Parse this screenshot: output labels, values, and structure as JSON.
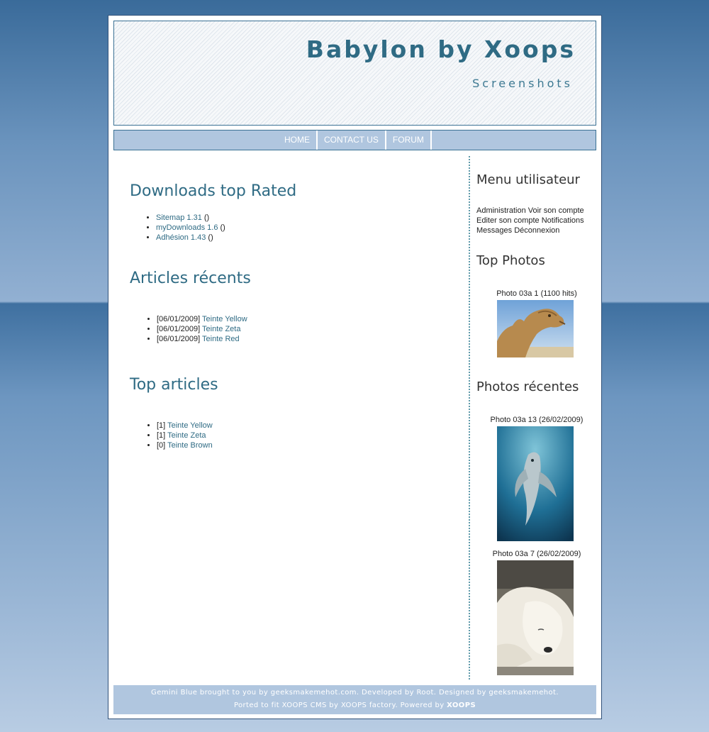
{
  "header": {
    "title": "Babylon by Xoops",
    "subtitle": "Screenshots"
  },
  "nav": {
    "items": [
      {
        "label": "HOME"
      },
      {
        "label": "CONTACT US"
      },
      {
        "label": "FORUM"
      }
    ]
  },
  "main": {
    "downloads": {
      "title": "Downloads top Rated",
      "items": [
        {
          "link": "Sitemap 1.31",
          "suffix": " ()"
        },
        {
          "link": "myDownloads 1.6",
          "suffix": " ()"
        },
        {
          "link": "Adhésion 1.43",
          "suffix": " ()"
        }
      ]
    },
    "recent_articles": {
      "title": "Articles récents",
      "items": [
        {
          "prefix": "[06/01/2009] ",
          "link": "Teinte Yellow"
        },
        {
          "prefix": "[06/01/2009] ",
          "link": "Teinte Zeta"
        },
        {
          "prefix": "[06/01/2009] ",
          "link": "Teinte Red"
        }
      ]
    },
    "top_articles": {
      "title": "Top articles",
      "items": [
        {
          "prefix": "[1] ",
          "link": "Teinte Yellow"
        },
        {
          "prefix": "[1] ",
          "link": "Teinte Zeta"
        },
        {
          "prefix": "[0] ",
          "link": "Teinte Brown"
        }
      ]
    }
  },
  "sidebar": {
    "user_menu": {
      "title": "Menu utilisateur",
      "items": [
        "Administration",
        "Voir son compte",
        "Editer son compte",
        "Notifications",
        "Messages",
        "Déconnexion"
      ]
    },
    "top_photos": {
      "title": "Top Photos",
      "photo_caption": "Photo 03a 1 (1100 hits)"
    },
    "recent_photos": {
      "title": "Photos récentes",
      "photo1_caption": "Photo 03a 13 (26/02/2009)",
      "photo2_caption": "Photo 03a 7 (26/02/2009)"
    }
  },
  "footer": {
    "line1": "Gemini Blue brought to you by geeksmakemehot.com. Developed by Root. Designed by geeksmakemehot.",
    "line2_prefix": "Ported to fit XOOPS CMS by XOOPS factory. Powered by ",
    "line2_brand": "XOOPS"
  },
  "colors": {
    "accent": "#2f6b84",
    "nav_bg": "#b0c6df",
    "page_bg_top": "#3a6b9a"
  }
}
